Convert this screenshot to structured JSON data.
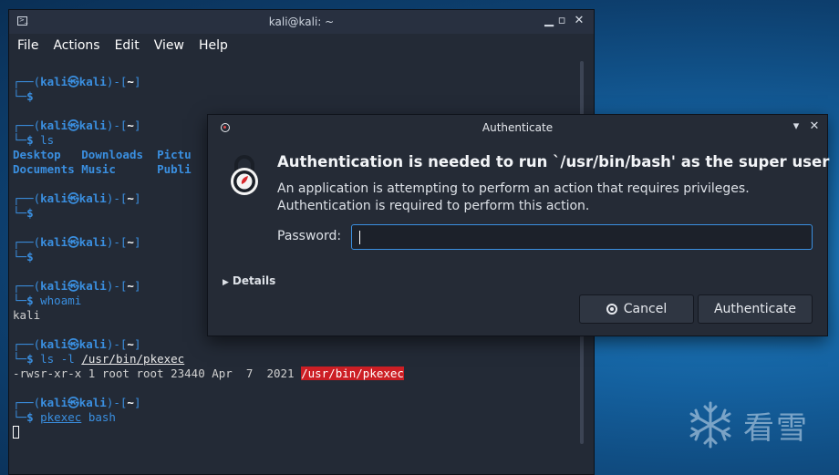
{
  "terminal": {
    "title": "kali@kali: ~",
    "menu": [
      "File",
      "Actions",
      "Edit",
      "View",
      "Help"
    ],
    "prompt_user": "kali",
    "prompt_at": "㉿",
    "prompt_host": "kali",
    "prompt_dir": "~",
    "prompt_symbol": "$",
    "commands": {
      "ls": "ls",
      "whoami": "whoami",
      "ls_l_cmd": "ls",
      "ls_l_flag": "-l",
      "ls_l_path": "/usr/bin/pkexec",
      "pkexec_cmd": "pkexec",
      "pkexec_arg": "bash"
    },
    "ls_output": {
      "row1": [
        "Desktop",
        "Downloads",
        "Pictu"
      ],
      "row2": [
        "Documents",
        "Music",
        "Publi"
      ]
    },
    "whoami_output": "kali",
    "ls_l_output_meta": "-rwsr-xr-x 1 root root 23440 Apr  7  2021 ",
    "ls_l_output_path": "/usr/bin/pkexec"
  },
  "dialog": {
    "title": "Authenticate",
    "headline": "Authentication is needed to run `/usr/bin/bash' as the super user",
    "description": "An application is attempting to perform an action that requires privileges. Authentication is required to perform this action.",
    "password_label": "Password:",
    "password_value": "",
    "details_label": "Details",
    "cancel_label": "Cancel",
    "authenticate_label": "Authenticate",
    "accent_color": "#3a8fe0"
  },
  "watermark": {
    "text": "看雪"
  }
}
